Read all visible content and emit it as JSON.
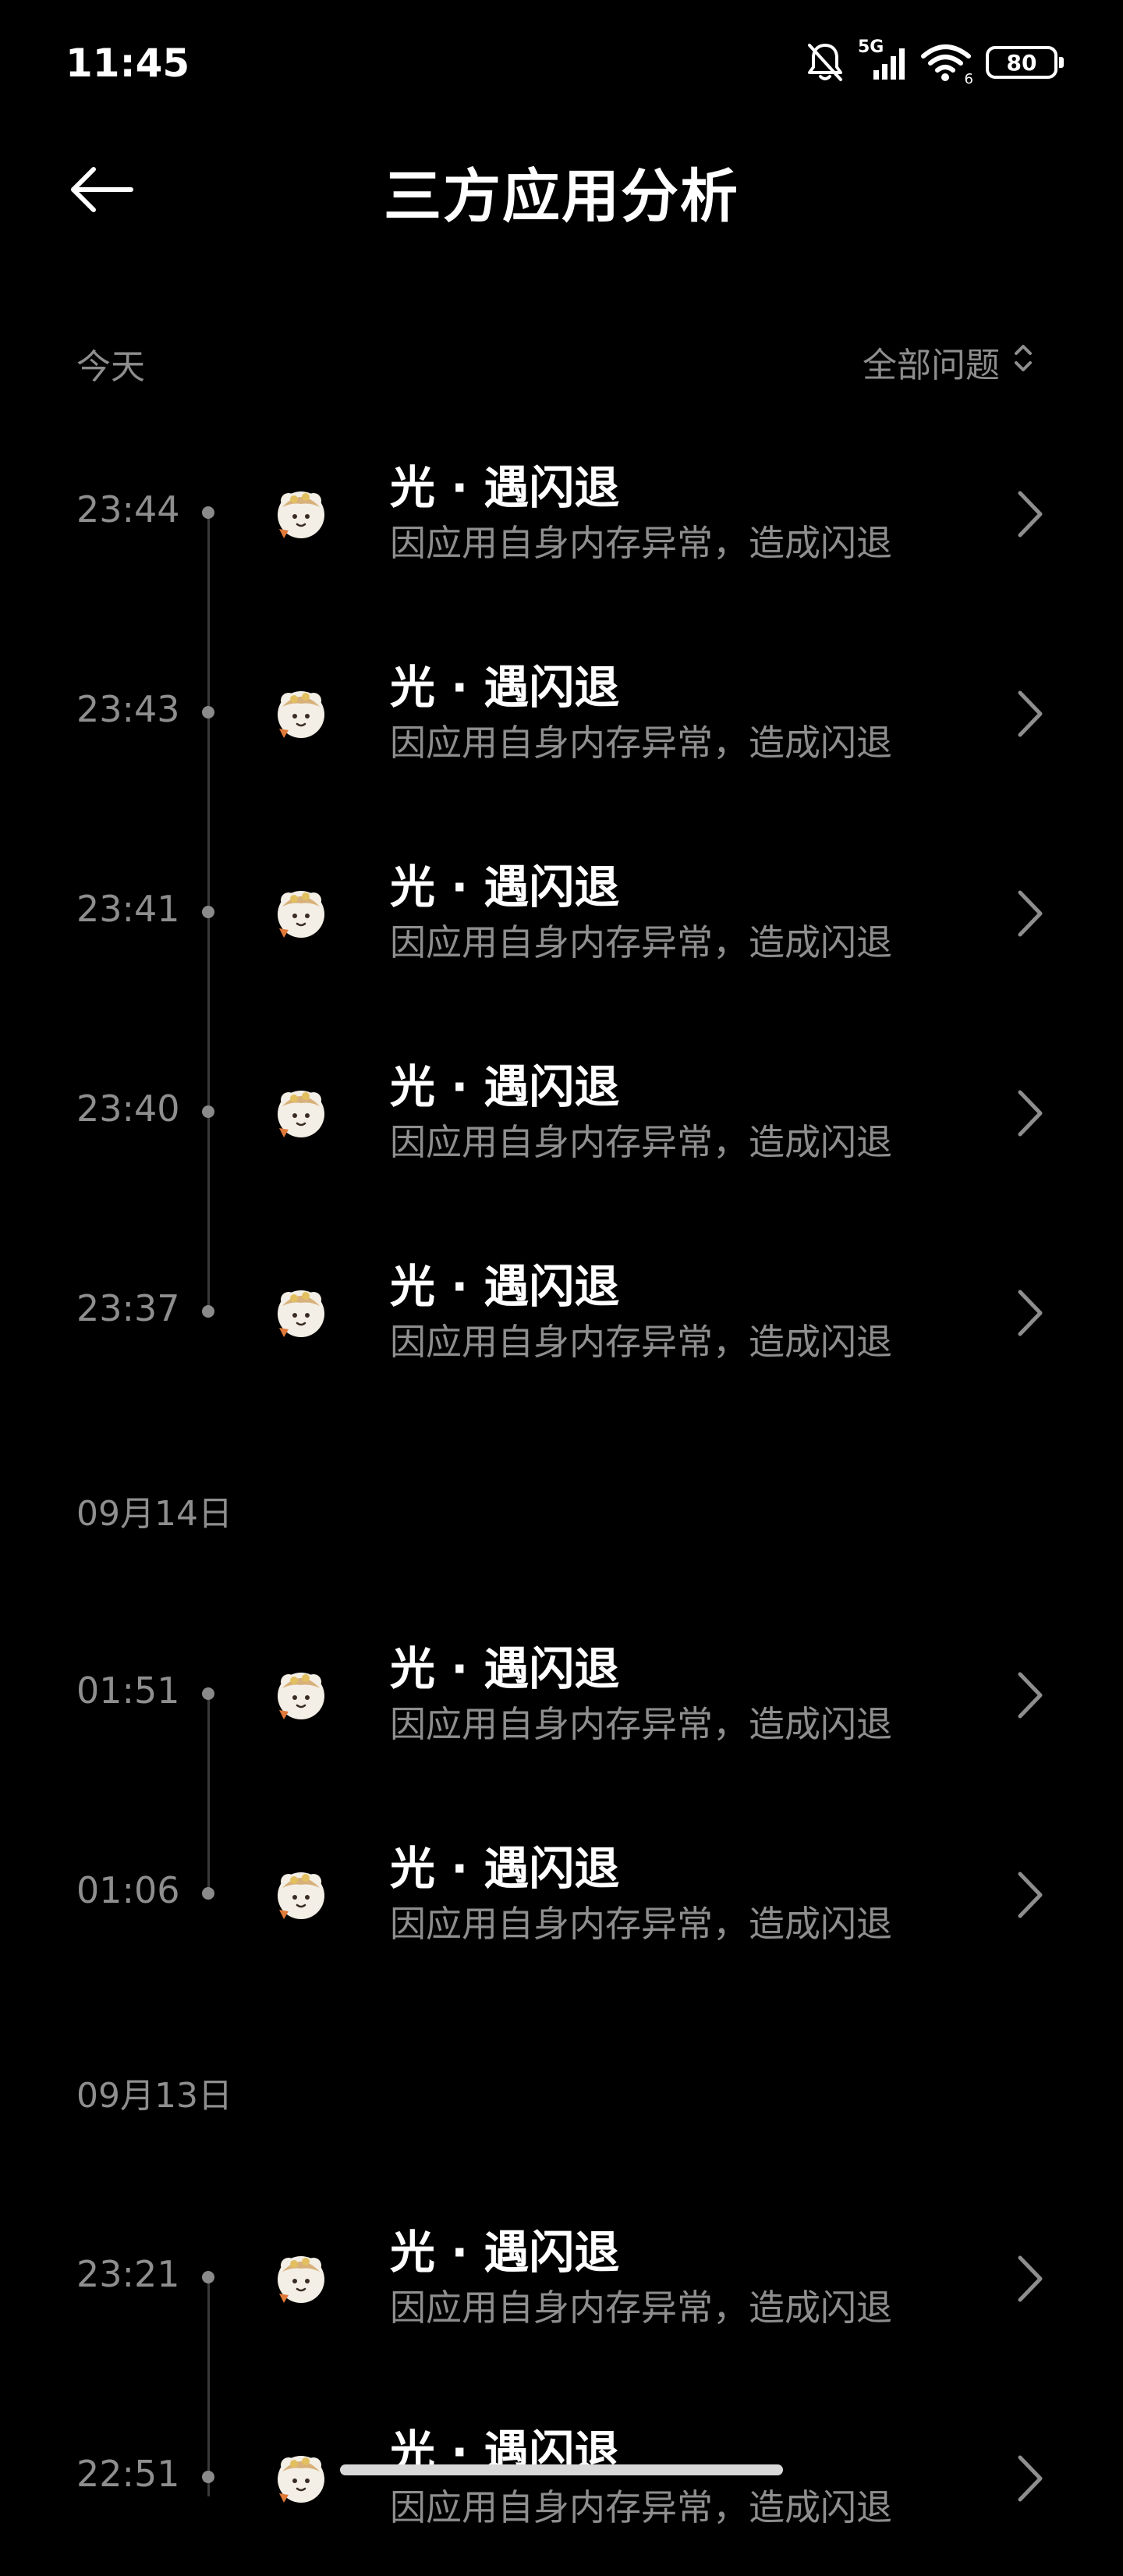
{
  "status_bar": {
    "time": "11:45",
    "network": "5G",
    "wifi_sub": "6",
    "battery": "80",
    "icons": [
      "bell-off-icon",
      "signal-icon",
      "wifi-icon",
      "battery-icon"
    ]
  },
  "header": {
    "title": "三方应用分析",
    "back_icon": "arrow-left-icon"
  },
  "filter": {
    "label": "全部问题",
    "icon": "sort-updown-icon"
  },
  "sections": [
    {
      "label": "今天",
      "items": [
        {
          "time": "23:44",
          "title": "光 · 遇闪退",
          "desc": "因应用自身内存异常，造成闪退"
        },
        {
          "time": "23:43",
          "title": "光 · 遇闪退",
          "desc": "因应用自身内存异常，造成闪退"
        },
        {
          "time": "23:41",
          "title": "光 · 遇闪退",
          "desc": "因应用自身内存异常，造成闪退"
        },
        {
          "time": "23:40",
          "title": "光 · 遇闪退",
          "desc": "因应用自身内存异常，造成闪退"
        },
        {
          "time": "23:37",
          "title": "光 · 遇闪退",
          "desc": "因应用自身内存异常，造成闪退"
        }
      ]
    },
    {
      "label": "09月14日",
      "items": [
        {
          "time": "01:51",
          "title": "光 · 遇闪退",
          "desc": "因应用自身内存异常，造成闪退"
        },
        {
          "time": "01:06",
          "title": "光 · 遇闪退",
          "desc": "因应用自身内存异常，造成闪退"
        }
      ]
    },
    {
      "label": "09月13日",
      "items": [
        {
          "time": "23:21",
          "title": "光 · 遇闪退",
          "desc": "因应用自身内存异常，造成闪退"
        },
        {
          "time": "22:51",
          "title": "光 · 遇闪退",
          "desc": "因应用自身内存异常，造成闪退"
        }
      ]
    }
  ],
  "colors": {
    "background": "#000000",
    "primary_text": "#ffffff",
    "secondary_text": "#8e8e8e",
    "timeline": "#3a3a3a"
  }
}
